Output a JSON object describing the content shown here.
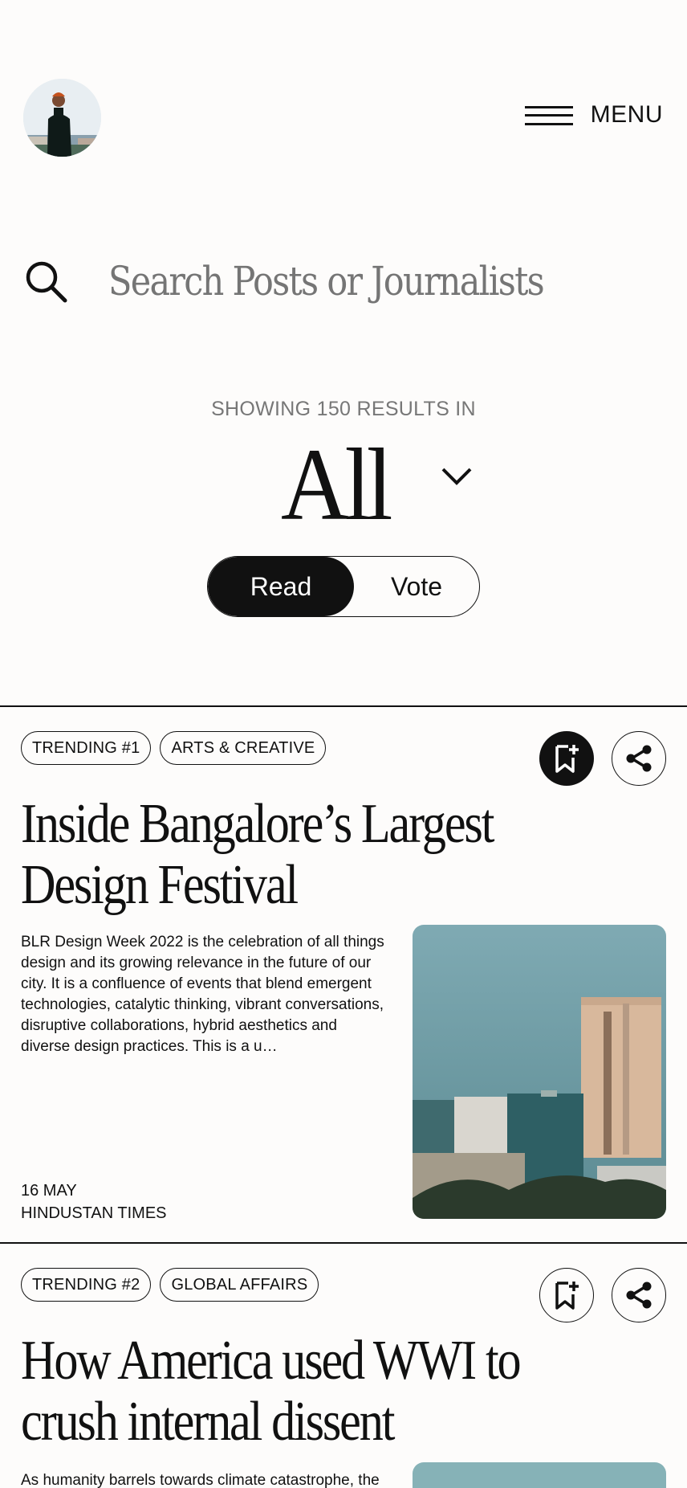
{
  "header": {
    "menu_label": "MENU"
  },
  "search": {
    "placeholder": "Search Posts or Journalists"
  },
  "results": {
    "label": "SHOWING 150 RESULTS IN",
    "category": "All"
  },
  "mode_toggle": {
    "options": [
      "Read",
      "Vote"
    ],
    "selected": "Read"
  },
  "posts": [
    {
      "tags": [
        "TRENDING #1",
        "ARTS & CREATIVE"
      ],
      "bookmarked": true,
      "title": "Inside Bangalore’s Largest Design Festival",
      "excerpt": "BLR Design Week 2022 is the celebration of all things design and its growing relevance in the future of our city. It is a confluence of events that blend emergent technologies, catalytic thinking, vibrant conversations, disruptive collaborations, hybrid aesthetics and diverse design practices. This is a u…",
      "date": "16 MAY",
      "source": "HINDUSTAN TIMES"
    },
    {
      "tags": [
        "TRENDING #2",
        "GLOBAL AFFAIRS"
      ],
      "bookmarked": false,
      "title": "How America used WWI to crush internal dissent",
      "excerpt": "As humanity barrels towards climate catastrophe, the",
      "date": "",
      "source": ""
    }
  ],
  "icons": {
    "search": "search-icon",
    "menu": "hamburger-icon",
    "dropdown": "chevron-down-icon",
    "bookmark": "bookmark-add-icon",
    "share": "share-icon"
  }
}
